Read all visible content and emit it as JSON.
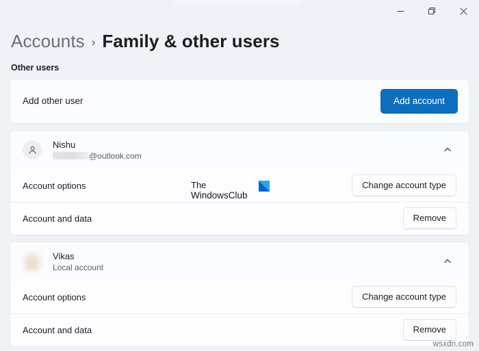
{
  "window": {
    "controls": [
      {
        "name": "minimize",
        "label": "–"
      },
      {
        "name": "maximize",
        "label": "□"
      },
      {
        "name": "close",
        "label": "✕"
      }
    ]
  },
  "header": {
    "breadcrumb_parent": "Accounts",
    "breadcrumb_separator": "›",
    "breadcrumb_current": "Family & other users",
    "section_label": "Other users"
  },
  "add_user": {
    "label": "Add other user",
    "button": "Add account"
  },
  "accounts": [
    {
      "name": "Nishu",
      "subtitle_redacted": true,
      "subtitle": "@outlook.com",
      "avatar_type": "person-icon",
      "expanded": true,
      "rows": [
        {
          "label": "Account options",
          "button": "Change account type"
        },
        {
          "label": "Account and data",
          "button": "Remove"
        }
      ]
    },
    {
      "name": "Vikas",
      "subtitle_redacted": false,
      "subtitle": "Local account",
      "avatar_type": "blurred-photo",
      "expanded": true,
      "rows": [
        {
          "label": "Account options",
          "button": "Change account type"
        },
        {
          "label": "Account and data",
          "button": "Remove"
        }
      ]
    }
  ],
  "watermarks": {
    "brand_line1": "The",
    "brand_line2": "WindowsClub",
    "corner": "wsxdn.com"
  },
  "colors": {
    "page_background": "#eff2f7",
    "card_background": "#fbfcfe",
    "accent": "#0d6ebe",
    "text_primary": "#1b1d22",
    "text_secondary": "#565c67",
    "brand_logo_light": "#2aa7f0",
    "brand_logo_dark": "#0b63c9"
  }
}
